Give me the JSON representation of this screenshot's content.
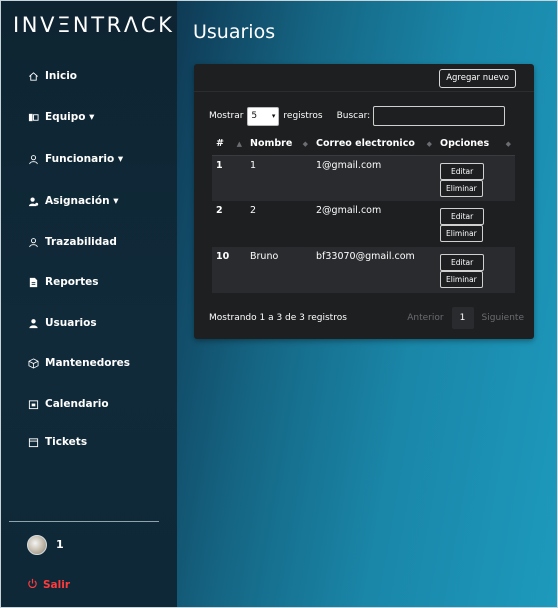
{
  "app": {
    "brand": "INVΞNTRΛCK"
  },
  "sidebar": {
    "items": [
      {
        "label": "Inicio",
        "icon": "home-icon"
      },
      {
        "label": "Equipo ▾",
        "icon": "equipment-icon"
      },
      {
        "label": "Funcionario ▾",
        "icon": "employee-icon"
      },
      {
        "label": "Asignación ▾",
        "icon": "assign-icon"
      },
      {
        "label": "Trazabilidad",
        "icon": "trace-icon"
      },
      {
        "label": "Reportes",
        "icon": "report-icon"
      },
      {
        "label": "Usuarios",
        "icon": "users-icon"
      },
      {
        "label": "Mantenedores",
        "icon": "box-icon"
      },
      {
        "label": "Calendario",
        "icon": "calendar-icon"
      },
      {
        "label": "Tickets",
        "icon": "ticket-icon"
      }
    ],
    "user": {
      "name": "1"
    },
    "logout_label": "Salir"
  },
  "main": {
    "title": "Usuarios",
    "add_button": "Agregar nuevo",
    "controls": {
      "show_label": "Mostrar",
      "page_size": "5",
      "records_label": "registros",
      "search_label": "Buscar:",
      "search_value": ""
    },
    "table": {
      "columns": [
        "#",
        "Nombre",
        "Correo electronico",
        "Opciones"
      ],
      "rows": [
        {
          "id": "1",
          "name": "1",
          "email": "1@gmail.com",
          "edit": "Editar",
          "delete": "Eliminar"
        },
        {
          "id": "2",
          "name": "2",
          "email": "2@gmail.com",
          "edit": "Editar",
          "delete": "Eliminar"
        },
        {
          "id": "10",
          "name": "Bruno",
          "email": "bf33070@gmail.com",
          "edit": "Editar",
          "delete": "Eliminar"
        }
      ]
    },
    "footer": {
      "info": "Mostrando 1 a 3 de 3 registros",
      "prev": "Anterior",
      "page": "1",
      "next": "Siguiente"
    }
  },
  "colors": {
    "sidebar_bg": "#0e2431",
    "card_bg": "#1e1f21",
    "logout": "#ff3b3b",
    "main_gradient_start": "#0f3a55",
    "main_gradient_end": "#1d9abd"
  }
}
